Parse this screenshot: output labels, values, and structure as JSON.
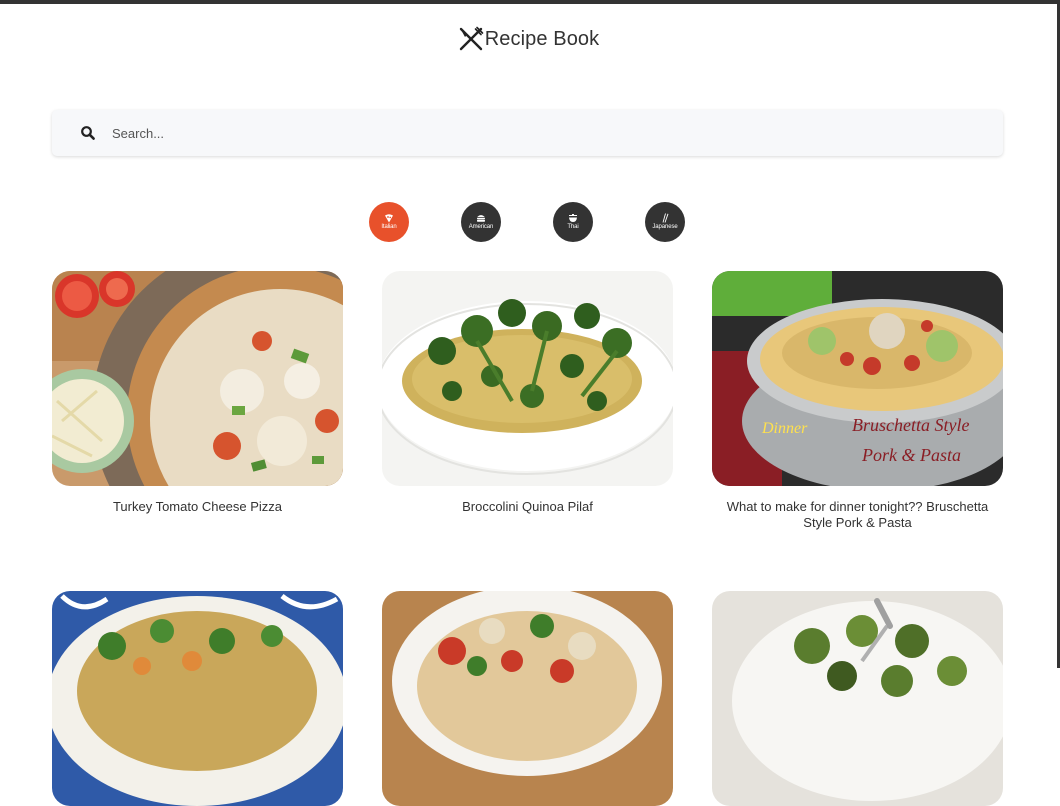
{
  "header": {
    "title": "Recipe Book",
    "logo_icon": "fork-knife-icon"
  },
  "search": {
    "placeholder": "Search...",
    "value": "",
    "icon": "search-icon"
  },
  "categories": [
    {
      "label": "Italian",
      "icon": "pizza-slice-icon",
      "active": true,
      "color": "#e8512b"
    },
    {
      "label": "American",
      "icon": "burger-icon",
      "active": false,
      "color": "#333333"
    },
    {
      "label": "Thai",
      "icon": "bowl-icon",
      "active": false,
      "color": "#333333"
    },
    {
      "label": "Japanese",
      "icon": "chopsticks-icon",
      "active": false,
      "color": "#333333"
    }
  ],
  "recipes": [
    {
      "name": "Turkey Tomato Cheese Pizza",
      "image": "pizza-photo"
    },
    {
      "name": "Broccolini Quinoa Pilaf",
      "image": "quinoa-pilaf-photo"
    },
    {
      "name": "What to make for dinner tonight?? Bruschetta Style Pork & Pasta",
      "image": "pork-pasta-photo"
    },
    {
      "name": "",
      "image": "salad-photo"
    },
    {
      "name": "",
      "image": "pasta-bowl-photo"
    },
    {
      "name": "",
      "image": "brussels-sprouts-photo"
    }
  ],
  "colors": {
    "accent": "#e8512b",
    "dark": "#333333",
    "search_bg": "#f7f8fa"
  }
}
